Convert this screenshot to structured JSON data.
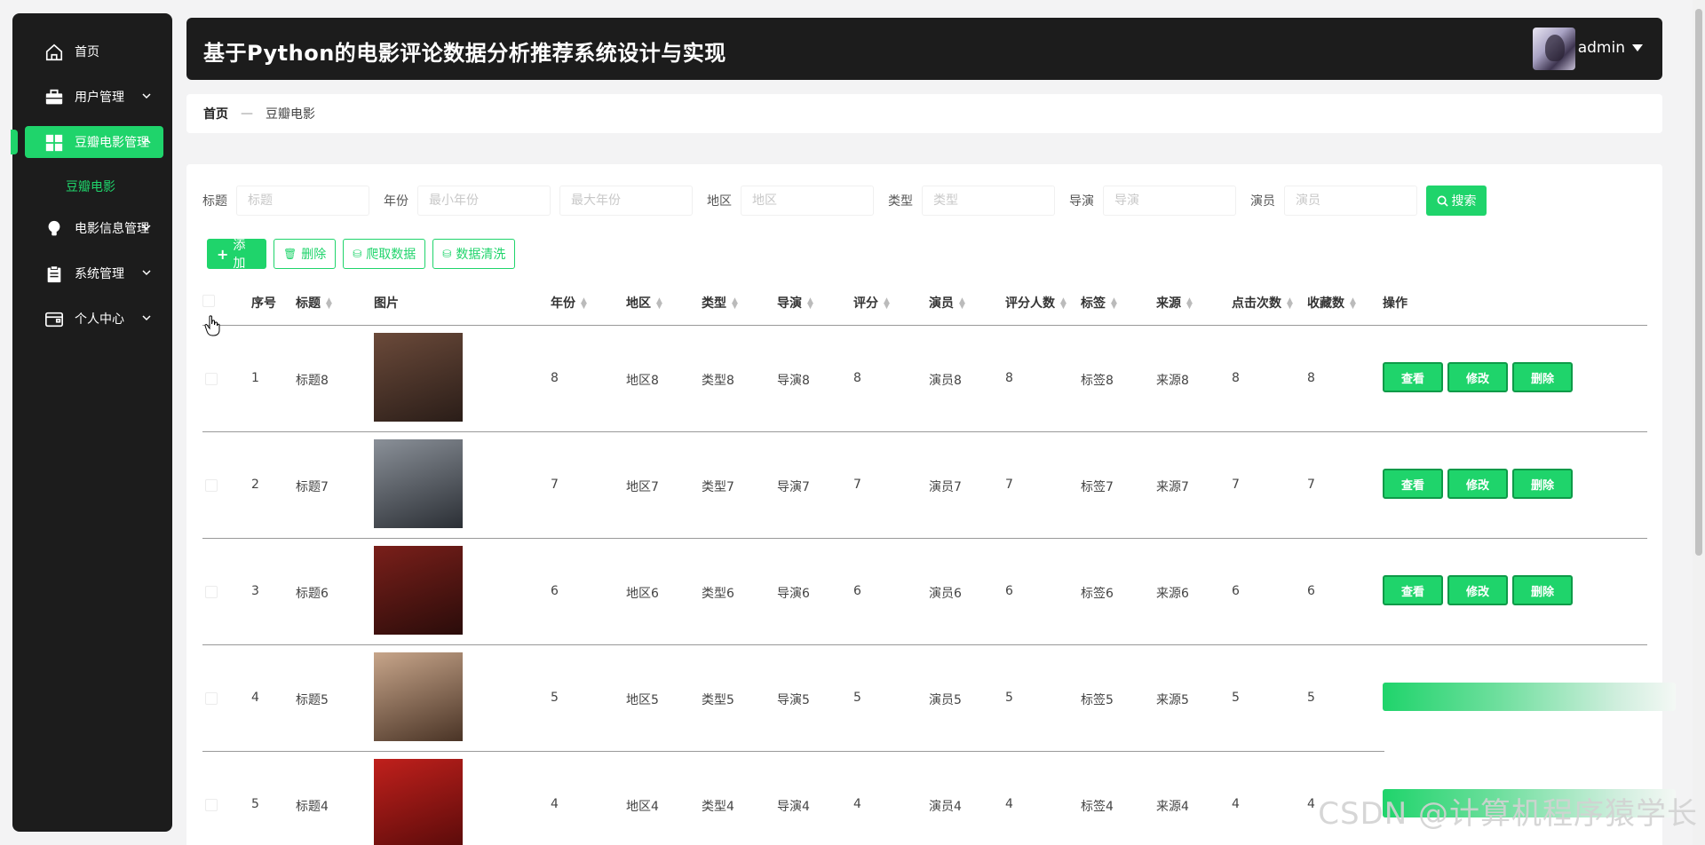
{
  "sidebar": {
    "items": [
      {
        "label": "首页",
        "icon": "home-icon"
      },
      {
        "label": "用户管理",
        "icon": "briefcase-icon"
      },
      {
        "label": "豆瓣电影管理",
        "icon": "grid-icon"
      },
      {
        "label": "电影信息管理",
        "icon": "bulb-icon"
      },
      {
        "label": "系统管理",
        "icon": "clipboard-icon"
      },
      {
        "label": "个人中心",
        "icon": "wallet-icon"
      }
    ],
    "sub_item": "豆瓣电影"
  },
  "header": {
    "title": "基于Python的电影评论数据分析推荐系统设计与实现",
    "user": "admin"
  },
  "breadcrumb": {
    "home": "首页",
    "sep": "—",
    "current": "豆瓣电影"
  },
  "search": {
    "title_label": "标题",
    "title_placeholder": "标题",
    "year_label": "年份",
    "year_min_placeholder": "最小年份",
    "year_max_placeholder": "最大年份",
    "region_label": "地区",
    "region_placeholder": "地区",
    "type_label": "类型",
    "type_placeholder": "类型",
    "director_label": "导演",
    "director_placeholder": "导演",
    "actor_label": "演员",
    "actor_placeholder": "演员",
    "button": "搜索"
  },
  "actions": {
    "add": "添加",
    "delete": "删除",
    "crawl": "爬取数据",
    "clean": "数据清洗"
  },
  "table": {
    "headers": {
      "index": "序号",
      "title": "标题",
      "image": "图片",
      "year": "年份",
      "region": "地区",
      "type": "类型",
      "director": "导演",
      "score": "评分",
      "actor": "演员",
      "raters": "评分人数",
      "tag": "标签",
      "source": "来源",
      "clicks": "点击次数",
      "favorites": "收藏数",
      "ops": "操作"
    },
    "row_buttons": {
      "view": "查看",
      "edit": "修改",
      "delete": "删除"
    },
    "rows": [
      {
        "index": "1",
        "title": "标题8",
        "year": "8",
        "region": "地区8",
        "type": "类型8",
        "director": "导演8",
        "score": "8",
        "actor": "演员8",
        "raters": "8",
        "tag": "标签8",
        "source": "来源8",
        "clicks": "8",
        "favorites": "8",
        "poster_colors": [
          "#6b4a3a",
          "#2a1d18"
        ]
      },
      {
        "index": "2",
        "title": "标题7",
        "year": "7",
        "region": "地区7",
        "type": "类型7",
        "director": "导演7",
        "score": "7",
        "actor": "演员7",
        "raters": "7",
        "tag": "标签7",
        "source": "来源7",
        "clicks": "7",
        "favorites": "7",
        "poster_colors": [
          "#8a9098",
          "#2b2f35"
        ]
      },
      {
        "index": "3",
        "title": "标题6",
        "year": "6",
        "region": "地区6",
        "type": "类型6",
        "director": "导演6",
        "score": "6",
        "actor": "演员6",
        "raters": "6",
        "tag": "标签6",
        "source": "来源6",
        "clicks": "6",
        "favorites": "6",
        "poster_colors": [
          "#7a1f1a",
          "#2a0c0a"
        ]
      },
      {
        "index": "4",
        "title": "标题5",
        "year": "5",
        "region": "地区5",
        "type": "类型5",
        "director": "导演5",
        "score": "5",
        "actor": "演员5",
        "raters": "5",
        "tag": "标签5",
        "source": "来源5",
        "clicks": "5",
        "favorites": "5",
        "poster_colors": [
          "#c7a58a",
          "#4a3426"
        ]
      },
      {
        "index": "5",
        "title": "标题4",
        "year": "4",
        "region": "地区4",
        "type": "类型4",
        "director": "导演4",
        "score": "4",
        "actor": "演员4",
        "raters": "4",
        "tag": "标签4",
        "source": "来源4",
        "clicks": "4",
        "favorites": "4",
        "poster_colors": [
          "#c0201c",
          "#5a0b0a"
        ]
      }
    ]
  },
  "watermark": "CSDN @计算机程序猿学长",
  "colors": {
    "accent": "#1fd46b",
    "dark": "#1c1c1c"
  }
}
